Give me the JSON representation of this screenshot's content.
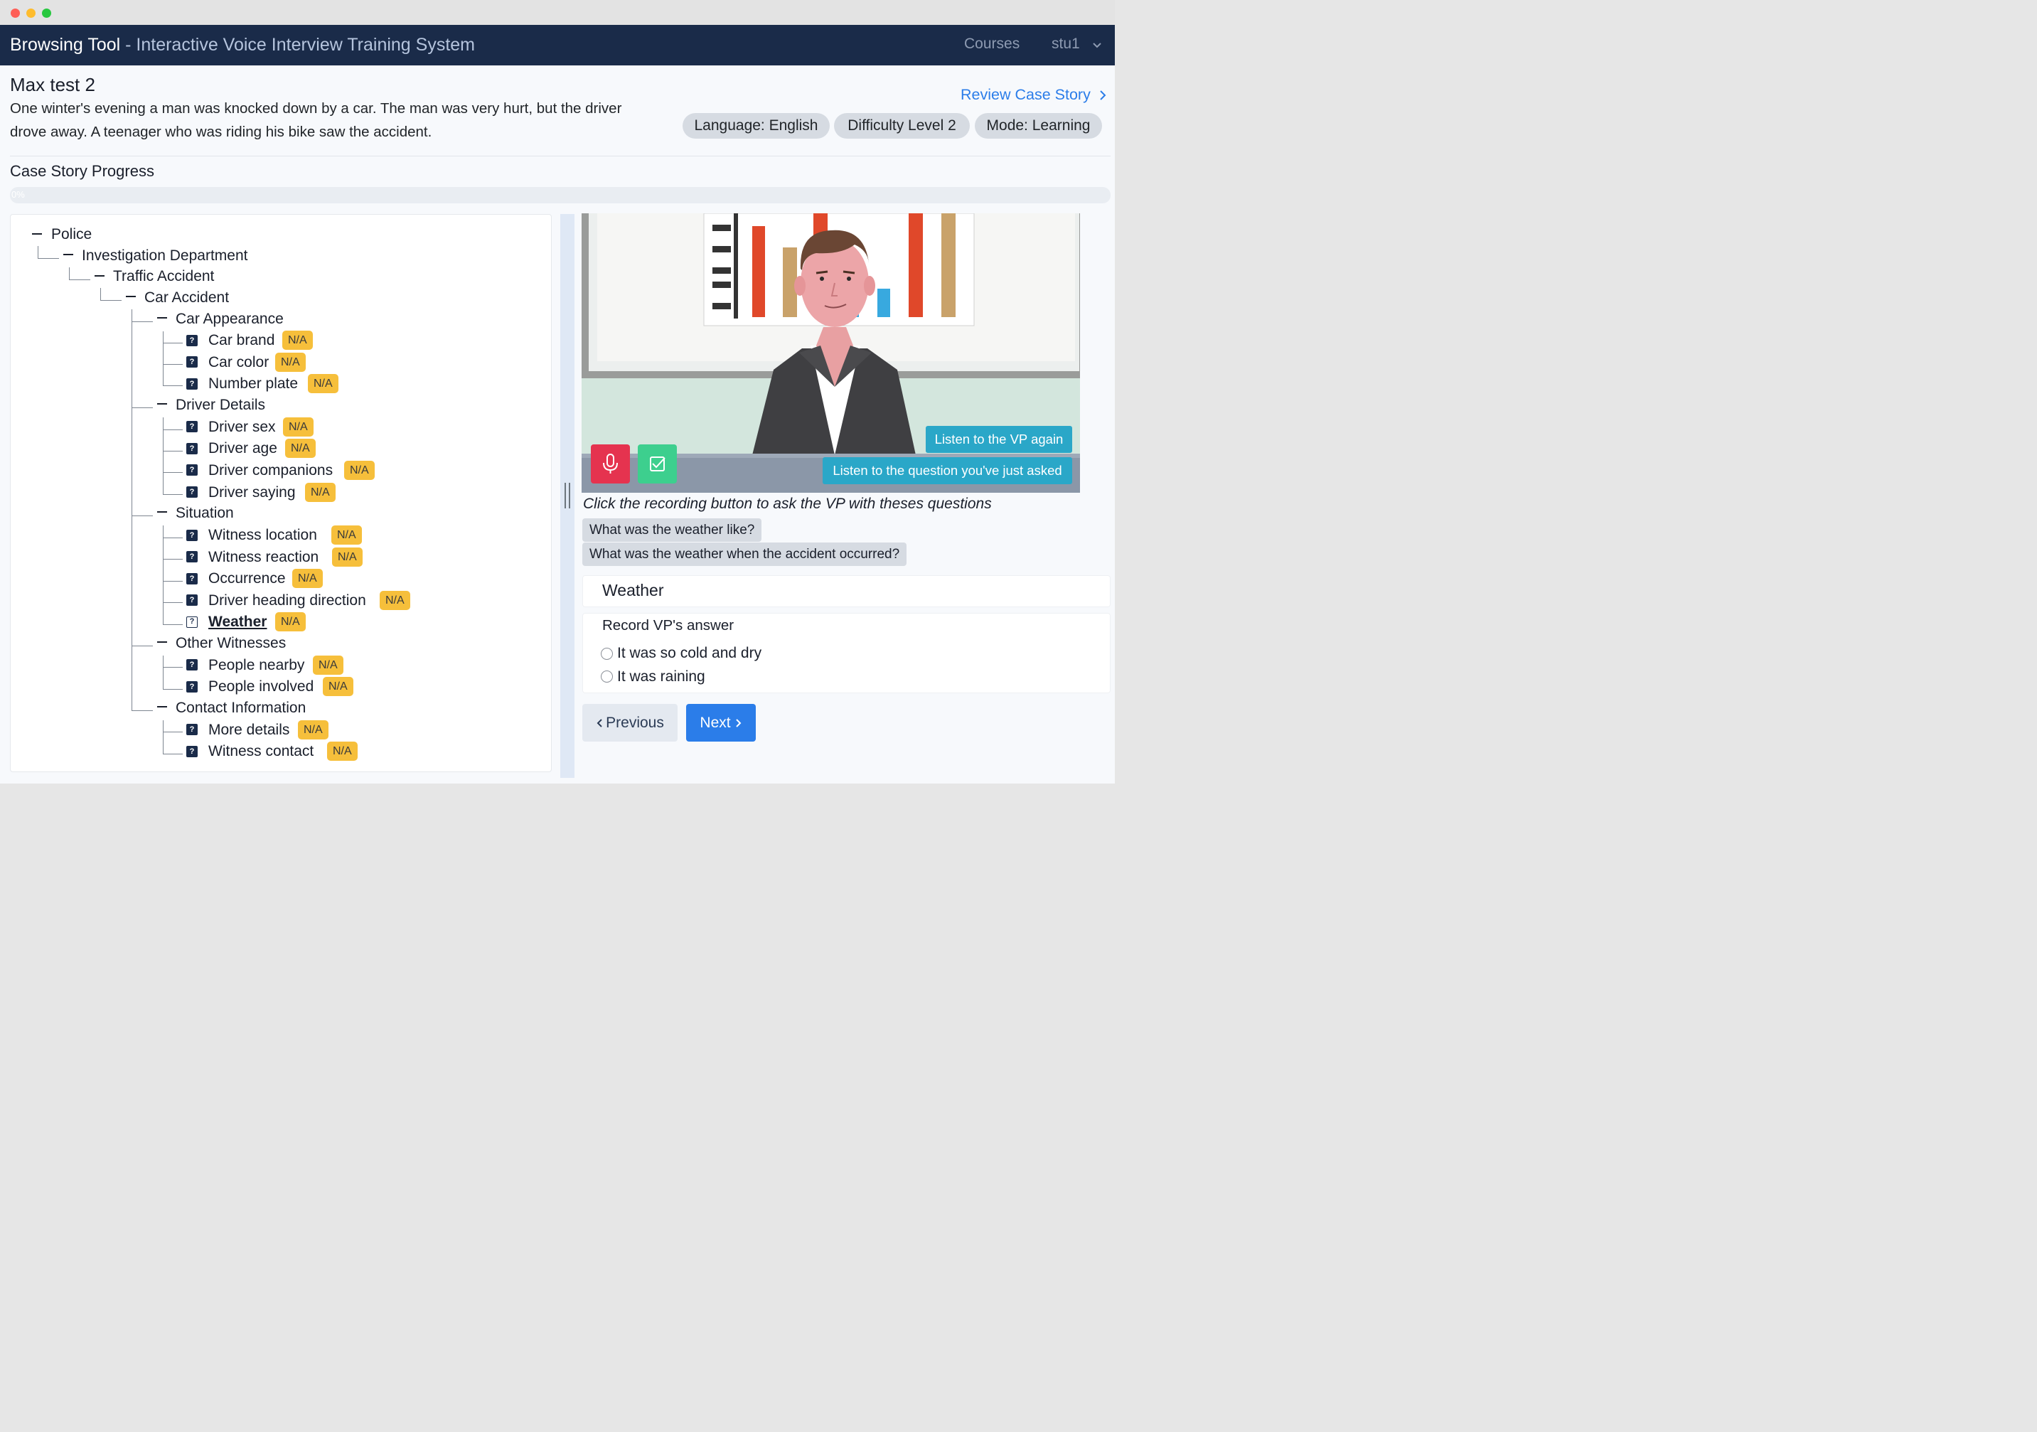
{
  "navbar": {
    "brand": "Browsing Tool",
    "subtitle": " - Interactive Voice Interview Training System",
    "courses": "Courses",
    "user": "stu1"
  },
  "case": {
    "title": "Max test 2",
    "description": "One winter's evening a man was knocked down by a car. The man was very hurt, but the driver drove away. A teenager who was riding his bike saw the accident.",
    "review_link": "Review Case Story",
    "pills": [
      "Language: English",
      "Difficulty Level 2",
      "Mode: Learning"
    ]
  },
  "progress": {
    "title": "Case Story Progress",
    "value_text": "0%",
    "value": 0
  },
  "tree": {
    "nodes": [
      {
        "label": "Police"
      },
      {
        "label": "Investigation Department"
      },
      {
        "label": "Traffic Accident"
      },
      {
        "label": "Car Accident"
      },
      {
        "label": "Car Appearance"
      },
      {
        "label": "Car brand",
        "badge": "N/A"
      },
      {
        "label": "Car color",
        "badge": "N/A"
      },
      {
        "label": "Number plate",
        "badge": "N/A"
      },
      {
        "label": "Driver Details"
      },
      {
        "label": "Driver sex",
        "badge": "N/A"
      },
      {
        "label": "Driver age",
        "badge": "N/A"
      },
      {
        "label": "Driver companions",
        "badge": "N/A"
      },
      {
        "label": "Driver saying",
        "badge": "N/A"
      },
      {
        "label": "Situation"
      },
      {
        "label": "Witness location",
        "badge": "N/A"
      },
      {
        "label": "Witness reaction",
        "badge": "N/A"
      },
      {
        "label": "Occurrence",
        "badge": "N/A"
      },
      {
        "label": "Driver heading direction",
        "badge": "N/A"
      },
      {
        "label": "Weather",
        "badge": "N/A",
        "active": true
      },
      {
        "label": "Other Witnesses"
      },
      {
        "label": "People nearby",
        "badge": "N/A"
      },
      {
        "label": "People involved",
        "badge": "N/A"
      },
      {
        "label": "Contact Information"
      },
      {
        "label": "More details",
        "badge": "N/A"
      },
      {
        "label": "Witness contact",
        "badge": "N/A"
      }
    ]
  },
  "video": {
    "listen_vp": "Listen to the VP again",
    "listen_question": "Listen to the question you've just asked"
  },
  "questions": {
    "instruction": "Click the recording button to ask the VP with theses questions",
    "items": [
      "What was the weather like?",
      "What was the weather when the accident occurred?"
    ]
  },
  "topic": {
    "title": "Weather"
  },
  "answer": {
    "title": "Record VP's answer",
    "options": [
      "It was so cold and dry",
      "It was raining"
    ]
  },
  "nav_buttons": {
    "previous": "Previous",
    "next": "Next"
  },
  "colors": {
    "navbar": "#1a2b49",
    "link": "#2b7de9",
    "badge": "#f6bf3b",
    "mic": "#e5334f",
    "check": "#3dcf8e",
    "teal": "#2aa7c8"
  }
}
